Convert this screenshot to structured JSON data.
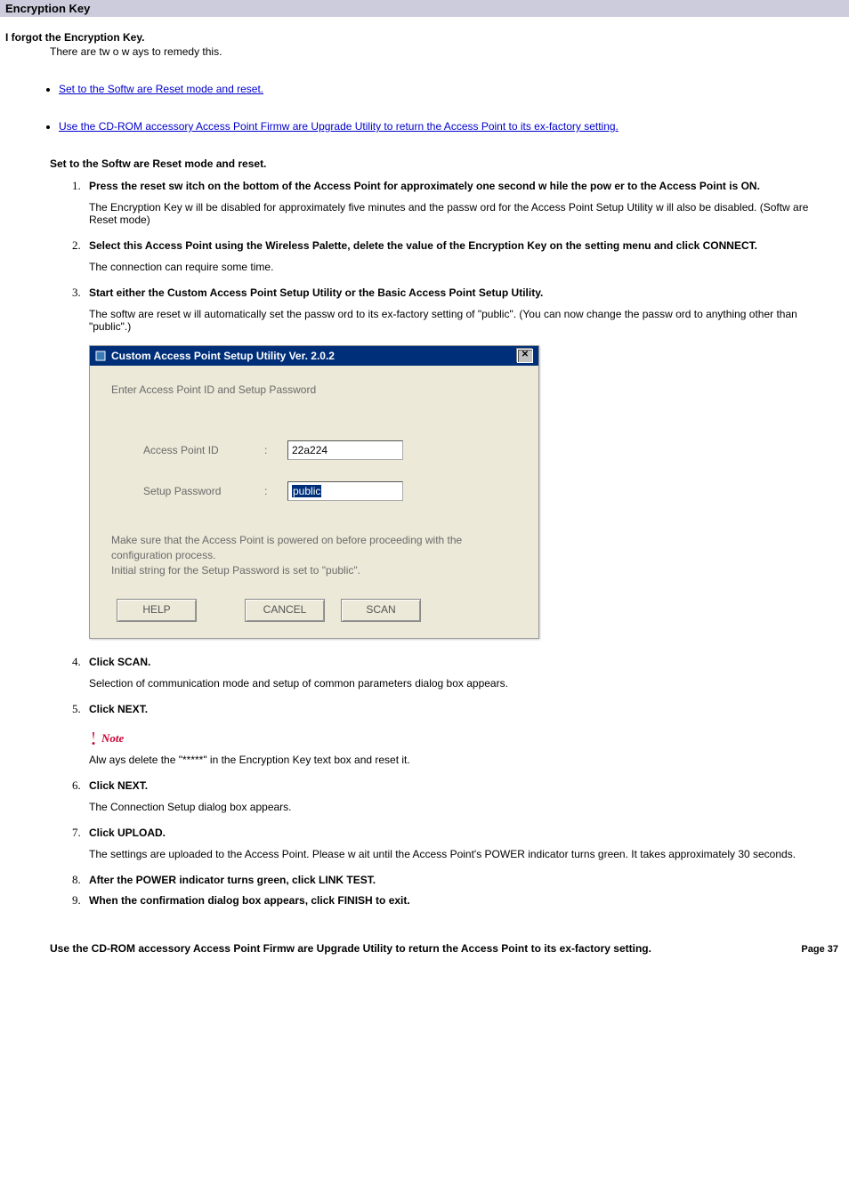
{
  "header": {
    "title": "Encryption Key"
  },
  "intro": {
    "heading": "I forgot the Encryption Key.",
    "text": "There are tw o w ays to remedy this."
  },
  "links": {
    "reset": "Set to the Softw are Reset mode and reset.",
    "cdrom": "Use the CD-ROM accessory Access Point Firmw are Upgrade Utility to return the Access Point to its ex-factory setting."
  },
  "section1": {
    "title": "Set to the Softw are Reset mode and reset.",
    "steps": {
      "s1_bold": "Press the reset sw itch on the bottom of the Access Point for approximately one second w hile the pow er to the Access Point is ON.",
      "s1_body": "The Encryption Key w ill be disabled for approximately five minutes and the passw ord for the Access Point Setup Utility w ill also be disabled. (Softw are Reset mode)",
      "s2_bold": "Select this Access Point using the Wireless Palette, delete the value of the Encryption Key on the setting menu and click CONNECT.",
      "s2_body": "The connection can require some time.",
      "s3_bold": "Start either the Custom Access Point Setup Utility or the Basic Access Point Setup Utility.",
      "s3_body": "The softw are reset w ill automatically set the passw ord to its ex-factory setting of \"public\". (You can now  change the passw ord to anything other than \"public\".)",
      "s4_bold": "Click SCAN.",
      "s4_body": "Selection of communication mode and setup of common parameters dialog box appears.",
      "s5_bold": "Click NEXT.",
      "note_label": "Note",
      "note_body": "Alw ays delete the \"*****\" in the Encryption Key text box and reset it.",
      "s6_bold": "Click NEXT.",
      "s6_body": "The Connection Setup dialog box appears.",
      "s7_bold": "Click UPLOAD.",
      "s7_body": "The settings are uploaded to the Access Point. Please w ait until the Access Point's POWER indicator turns green. It takes approximately 30 seconds.",
      "s8_bold": "After the POWER indicator turns green, click LINK TEST.",
      "s9_bold": "When the confirmation dialog box appears, click FINISH to exit."
    }
  },
  "dialog": {
    "title": "Custom Access Point Setup Utility  Ver.  2.0.2",
    "instruction": "Enter Access Point ID and Setup Password",
    "field1_label": "Access Point ID",
    "field1_value": "22a224",
    "field2_label": "Setup Password",
    "field2_value": "public",
    "note_line1": "Make sure that the Access Point is powered on before proceeding with the configuration process.",
    "note_line2": "Initial string for the Setup Password is set to \"public\".",
    "btn_help": "HELP",
    "btn_cancel": "CANCEL",
    "btn_scan": "SCAN"
  },
  "section2": {
    "title": "Use the CD-ROM accessory Access Point Firmw are Upgrade Utility to return the Access Point to its ex-factory setting."
  },
  "page": {
    "num": "Page 37"
  }
}
